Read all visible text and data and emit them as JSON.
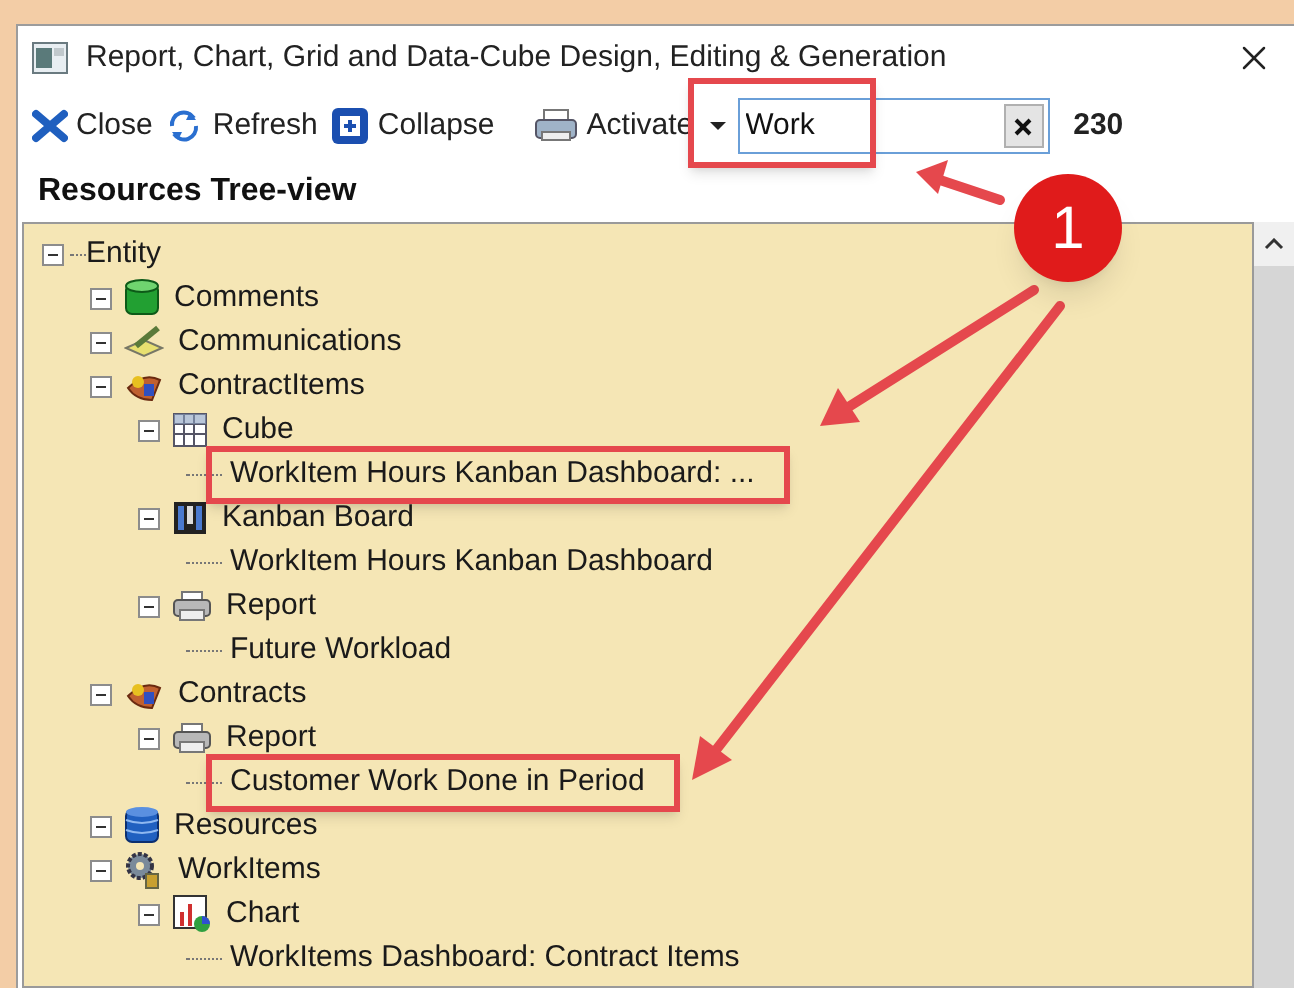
{
  "window": {
    "title": "Report, Chart, Grid and Data-Cube Design, Editing & Generation"
  },
  "toolbar": {
    "buttons": [
      {
        "kind": "close",
        "label": "Close"
      },
      {
        "kind": "refresh",
        "label": "Refresh"
      },
      {
        "kind": "collapse",
        "label": "Collapse"
      },
      {
        "kind": "activate",
        "label": "Activate"
      }
    ],
    "search": {
      "value": "Work",
      "highlighted": true
    },
    "count": "230"
  },
  "panel_title": "Resources Tree-view",
  "tree": [
    {
      "label": "Entity",
      "kind": "root",
      "expanded": true,
      "highlighted": false,
      "children": [
        {
          "label": "Comments",
          "kind": "table",
          "expanded": true,
          "highlighted": false
        },
        {
          "label": "Communications",
          "kind": "pen",
          "expanded": true,
          "highlighted": false
        },
        {
          "label": "ContractItems",
          "kind": "tools",
          "expanded": true,
          "highlighted": false,
          "children": [
            {
              "label": "Cube",
              "kind": "cube",
              "expanded": true,
              "highlighted": false,
              "children": [
                {
                  "label": "WorkItem Hours Kanban Dashboard: ...",
                  "kind": "leaf",
                  "highlighted": true
                }
              ]
            },
            {
              "label": "Kanban Board",
              "kind": "kanban",
              "expanded": true,
              "highlighted": false,
              "children": [
                {
                  "label": "WorkItem Hours Kanban Dashboard",
                  "kind": "leaf",
                  "highlighted": false
                }
              ]
            },
            {
              "label": "Report",
              "kind": "printer",
              "expanded": true,
              "highlighted": false,
              "children": [
                {
                  "label": "Future Workload",
                  "kind": "leaf",
                  "highlighted": false
                }
              ]
            }
          ]
        },
        {
          "label": "Contracts",
          "kind": "tools",
          "expanded": true,
          "highlighted": false,
          "children": [
            {
              "label": "Report",
              "kind": "printer",
              "expanded": true,
              "highlighted": false,
              "children": [
                {
                  "label": "Customer Work Done in Period",
                  "kind": "leaf",
                  "highlighted": true
                }
              ]
            }
          ]
        },
        {
          "label": "Resources",
          "kind": "database",
          "expanded": true,
          "highlighted": false
        },
        {
          "label": "WorkItems",
          "kind": "gears",
          "expanded": true,
          "highlighted": false,
          "children": [
            {
              "label": "Chart",
              "kind": "chart",
              "expanded": true,
              "highlighted": false,
              "children": [
                {
                  "label": "WorkItems Dashboard: Contract Items",
                  "kind": "leaf",
                  "highlighted": false
                }
              ]
            }
          ]
        }
      ]
    }
  ],
  "annotation": {
    "badge": "1"
  }
}
